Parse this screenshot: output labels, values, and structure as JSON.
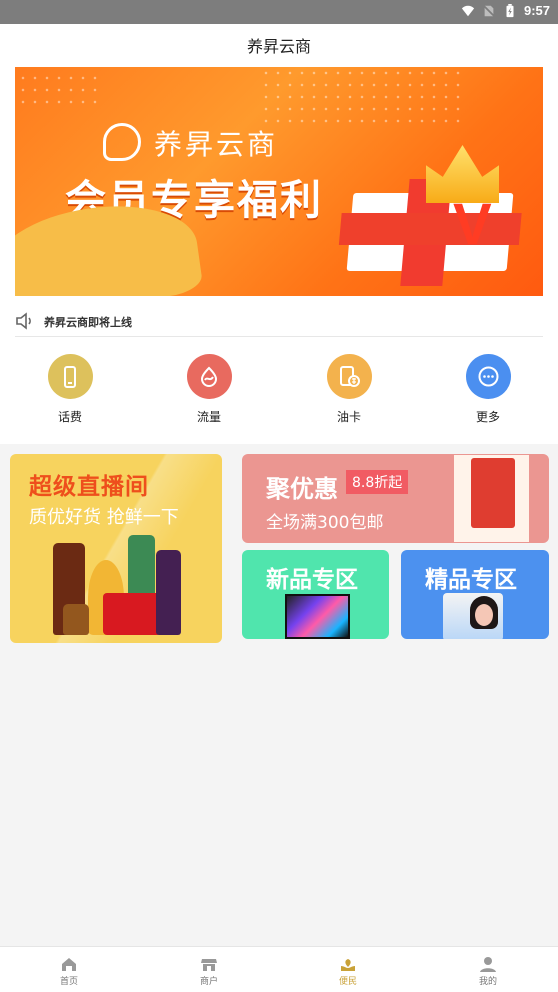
{
  "status_bar": {
    "time": "9:57",
    "icons": [
      "wifi-icon",
      "no-sim-icon",
      "battery-charging-icon"
    ]
  },
  "header": {
    "title": "养昇云商"
  },
  "banner": {
    "brand": "养昇云商",
    "slogan": "会员专享福利",
    "colors": {
      "background": "#ff7a1f",
      "accent": "#ffc83d"
    }
  },
  "notice": {
    "text": "养昇云商即将上线",
    "icon": "speaker-icon"
  },
  "quick_actions": [
    {
      "label": "话费",
      "icon": "phone-icon",
      "color": "#ddc15c"
    },
    {
      "label": "流量",
      "icon": "data-traffic-icon",
      "color": "#e86a5f"
    },
    {
      "label": "油卡",
      "icon": "fuel-card-icon",
      "color": "#f3b24d"
    },
    {
      "label": "更多",
      "icon": "more-icon",
      "color": "#4b8ff0"
    }
  ],
  "promotions": {
    "live": {
      "title": "超级直播间",
      "subtitle": "质优好货  抢鲜一下"
    },
    "deal": {
      "title": "聚优惠",
      "tag": "8.8折起",
      "subtitle": "全场满300包邮"
    },
    "new": {
      "title": "新品专区"
    },
    "premium": {
      "title": "精品专区"
    }
  },
  "bottom_nav": [
    {
      "label": "首页",
      "icon": "home-icon"
    },
    {
      "label": "商户",
      "icon": "store-icon"
    },
    {
      "label": "便民",
      "icon": "convenience-icon",
      "active": true
    },
    {
      "label": "我的",
      "icon": "profile-icon"
    }
  ]
}
